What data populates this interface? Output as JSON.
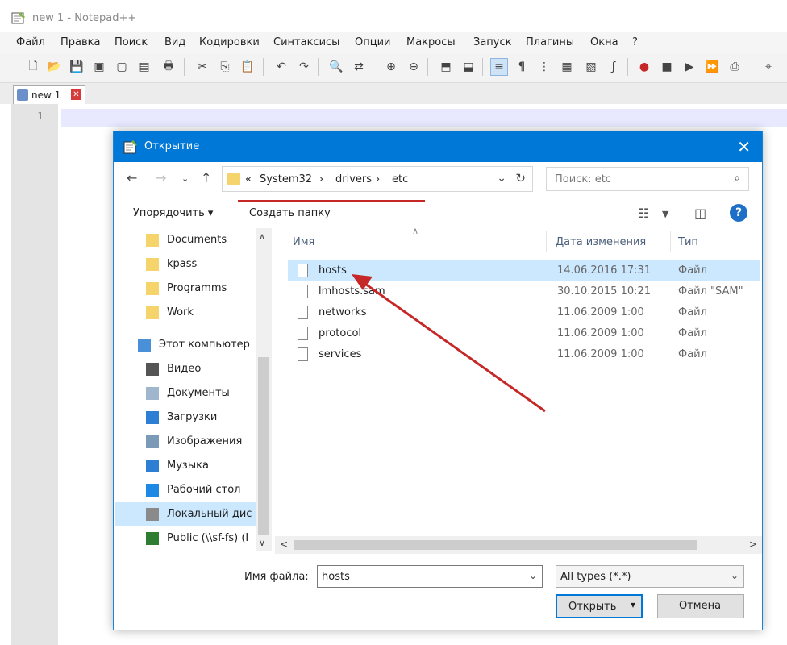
{
  "app": {
    "title": "new  1 - Notepad++",
    "menu": [
      "Файл",
      "Правка",
      "Поиск",
      "Вид",
      "Кодировки",
      "Синтаксисы",
      "Опции",
      "Макросы",
      "Запуск",
      "Плагины",
      "Окна",
      "?"
    ],
    "tab_label": "new  1",
    "line_number": "1"
  },
  "dialog": {
    "title": "Открытие",
    "breadcrumb": [
      "«",
      "System32",
      "›",
      "drivers",
      "›",
      "etc"
    ],
    "search_placeholder": "Поиск: etc",
    "organize_label": "Упорядочить ▾",
    "new_folder_label": "Создать папку",
    "help_label": "?",
    "nav_items": [
      {
        "label": "Documents",
        "icon": "pinned-folder-icon"
      },
      {
        "label": "kpass",
        "icon": "pinned-folder-icon"
      },
      {
        "label": "Programms",
        "icon": "pinned-folder-icon"
      },
      {
        "label": "Work",
        "icon": "pinned-folder-icon"
      },
      {
        "label": "Этот компьютер",
        "icon": "computer-icon"
      },
      {
        "label": "Видео",
        "icon": "video-icon"
      },
      {
        "label": "Документы",
        "icon": "documents-icon"
      },
      {
        "label": "Загрузки",
        "icon": "downloads-icon"
      },
      {
        "label": "Изображения",
        "icon": "pictures-icon"
      },
      {
        "label": "Музыка",
        "icon": "music-icon"
      },
      {
        "label": "Рабочий стол",
        "icon": "desktop-icon"
      },
      {
        "label": "Локальный дис",
        "icon": "local-disk-icon"
      },
      {
        "label": "Public (\\\\sf-fs) (I",
        "icon": "network-drive-icon"
      }
    ],
    "columns": [
      "Имя",
      "Дата изменения",
      "Тип"
    ],
    "files": [
      {
        "name": "hosts",
        "date": "14.06.2016 17:31",
        "type": "Файл"
      },
      {
        "name": "lmhosts.sam",
        "date": "30.10.2015 10:21",
        "type": "Файл \"SAM\""
      },
      {
        "name": "networks",
        "date": "11.06.2009 1:00",
        "type": "Файл"
      },
      {
        "name": "protocol",
        "date": "11.06.2009 1:00",
        "type": "Файл"
      },
      {
        "name": "services",
        "date": "11.06.2009 1:00",
        "type": "Файл"
      }
    ],
    "filename_label": "Имя файла:",
    "filename_value": "hosts",
    "filetype_value": "All types (*.*)",
    "open_label": "Открыть",
    "cancel_label": "Отмена"
  },
  "colors": {
    "accent": "#0078d7",
    "selection": "#cce8ff",
    "annotation": "#c62828"
  }
}
